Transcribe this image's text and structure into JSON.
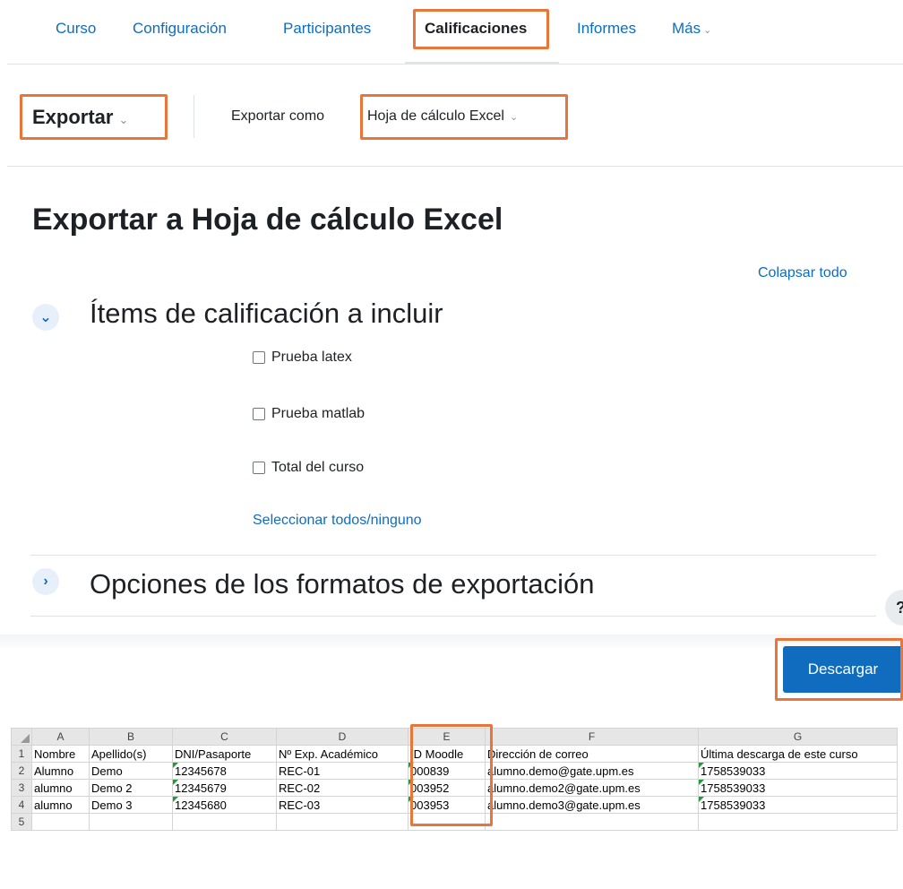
{
  "nav": {
    "tabs": [
      {
        "label": "Curso"
      },
      {
        "label": "Configuración"
      },
      {
        "label": "Participantes"
      },
      {
        "label": "Calificaciones",
        "active": true
      },
      {
        "label": "Informes"
      },
      {
        "label": "Más"
      }
    ]
  },
  "toolbar": {
    "title": "Exportar",
    "export_as_label": "Exportar como",
    "export_as_value": "Hoja de cálculo Excel"
  },
  "main": {
    "page_title": "Exportar a Hoja de cálculo Excel",
    "collapse_all": "Colapsar todo",
    "section1": {
      "title": "Ítems de calificación a incluir",
      "items": [
        {
          "label": "Prueba latex",
          "checked": false
        },
        {
          "label": "Prueba matlab",
          "checked": false
        },
        {
          "label": "Total del curso",
          "checked": false
        }
      ],
      "select_all": "Seleccionar todos/ninguno"
    },
    "section2": {
      "title": "Opciones de los formatos de exportación"
    },
    "help_label": "?",
    "download_label": "Descargar"
  },
  "spreadsheet": {
    "columns": [
      "A",
      "B",
      "C",
      "D",
      "E",
      "F",
      "G"
    ],
    "rows": [
      {
        "num": "1",
        "cells": [
          "Nombre",
          "Apellido(s)",
          "DNI/Pasaporte",
          "Nº Exp. Académico",
          "ID Moodle",
          "Dirección de correo",
          "Última descarga de este curso"
        ]
      },
      {
        "num": "2",
        "cells": [
          "Alumno",
          "Demo",
          "12345678",
          "REC-01",
          "000839",
          "alumno.demo@gate.upm.es",
          "1758539033"
        ]
      },
      {
        "num": "3",
        "cells": [
          "alumno",
          "Demo 2",
          "12345679",
          "REC-02",
          "003952",
          "alumno.demo2@gate.upm.es",
          "1758539033"
        ]
      },
      {
        "num": "4",
        "cells": [
          "alumno",
          "Demo 3",
          "12345680",
          "REC-03",
          "003953",
          "alumno.demo3@gate.upm.es",
          "1758539033"
        ]
      },
      {
        "num": "5",
        "cells": [
          "",
          "",
          "",
          "",
          "",
          "",
          ""
        ]
      }
    ]
  },
  "colors": {
    "link": "#0f6cbf",
    "highlight": "#e8763a",
    "button": "#0f6cbf"
  }
}
